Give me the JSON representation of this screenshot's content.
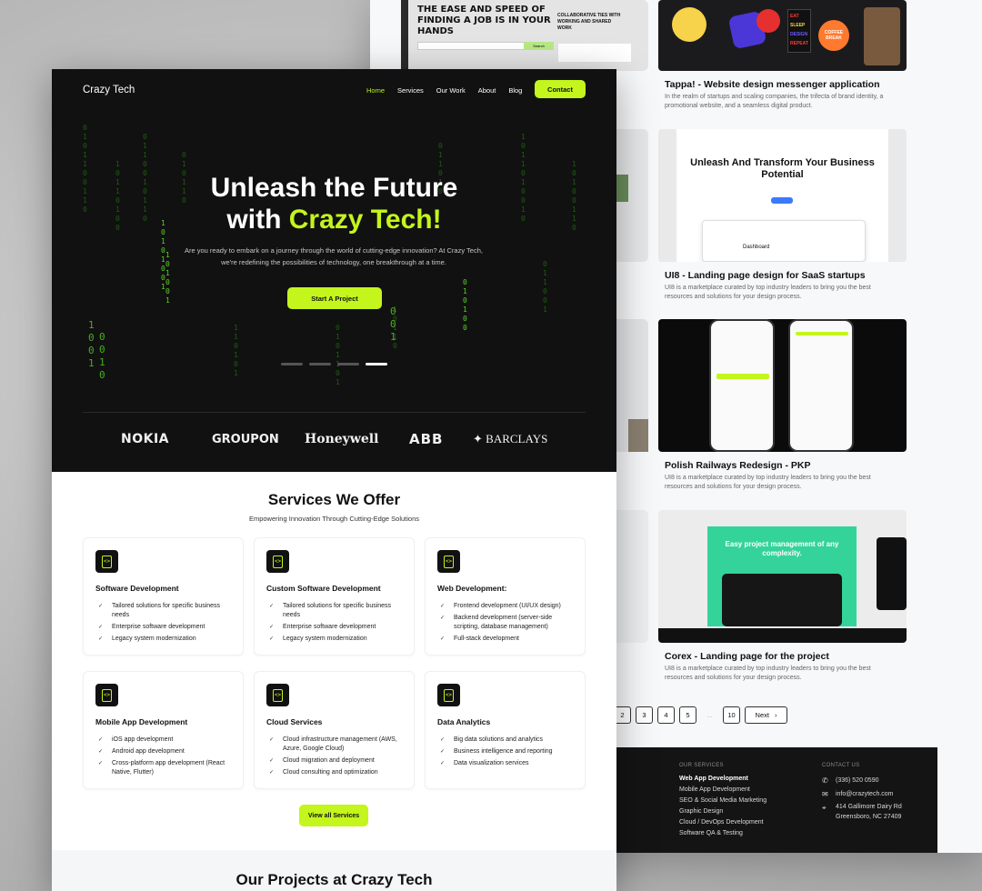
{
  "front": {
    "brand": "Crazy Tech",
    "nav": [
      "Home",
      "Services",
      "Our Work",
      "About",
      "Blog"
    ],
    "contact_label": "Contact",
    "hero": {
      "title_line1": "Unleash the Future",
      "title_line2_prefix": "with ",
      "title_line2_accent": "Crazy Tech!",
      "subtitle": "Are you ready to embark on a journey through the world of cutting-edge innovation? At Crazy Tech, we're redefining the possibilities of technology, one breakthrough at a time.",
      "cta": "Start A Project",
      "slides": 4,
      "active_slide": 4
    },
    "logos": [
      "NOKIA",
      "GROUPON",
      "Honeywell",
      "ABB",
      "BARCLAYS"
    ],
    "services": {
      "title": "Services We Offer",
      "subtitle": "Empowering Innovation Through Cutting-Edge Solutions",
      "cards": [
        {
          "title": "Software Development",
          "items": [
            "Tailored solutions for specific business needs",
            "Enterprise software development",
            "Legacy system modernization"
          ]
        },
        {
          "title": "Custom Software Development",
          "items": [
            "Tailored solutions for specific business needs",
            "Enterprise software development",
            "Legacy system modernization"
          ]
        },
        {
          "title": "Web Development:",
          "items": [
            "Frontend development (UI/UX design)",
            "Backend development (server-side scripting, database management)",
            "Full-stack development"
          ]
        },
        {
          "title": "Mobile App Development",
          "items": [
            "iOS app development",
            "Android app development",
            "Cross-platform app development (React Native, Flutter)"
          ]
        },
        {
          "title": "Cloud Services",
          "items": [
            "Cloud infrastructure management (AWS, Azure, Google Cloud)",
            "Cloud migration and deployment",
            "Cloud consulting and optimization"
          ]
        },
        {
          "title": "Data Analytics",
          "items": [
            "Big data solutions and analytics",
            "Business intelligence and reporting",
            "Data visualization services"
          ]
        }
      ],
      "view_all": "View all Services"
    },
    "projects_title": "Our Projects at Crazy Tech"
  },
  "back": {
    "projects": [
      {
        "title": "Tappa! - Website design messenger application",
        "desc": "In the realm of startups and scaling companies, the trifecta of brand identity, a promotional website, and a seamless digital product."
      },
      {
        "title": "UI8 - Landing page design for SaaS startups",
        "desc": "UI8 is a marketplace curated by top industry leaders to bring you the best resources and solutions for your design process."
      },
      {
        "title": "Polish Railways Redesign - PKP",
        "desc": "UI8 is a marketplace curated by top industry leaders to bring you the best resources and solutions for your design process."
      },
      {
        "title": "Corex - Landing page for the project",
        "desc": "UI8 is a marketplace curated by top industry leaders to bring you the best resources and solutions for your design process."
      }
    ],
    "thumbs": {
      "job_headline": "THE EASE AND SPEED OF FINDING A JOB IS IN YOUR HANDS",
      "job_side": "COLLABORATIVE TIES WITH WORKING AND SHARED WORK",
      "search_btn": "Search",
      "stickers": [
        "EAT",
        "SLEEP",
        "DESIGN",
        "REPEAT"
      ],
      "coffee": "COFFEE BREAK",
      "ui8_headline": "Unleash And Transform Your Business Potential",
      "ui8_dash": "Dashboard",
      "corex_headline": "Easy project management of any complexity."
    },
    "pagination": {
      "pages": [
        "2",
        "3",
        "4",
        "5",
        "...",
        "10"
      ],
      "next": "Next"
    },
    "footer": {
      "services_title": "OUR SERVICES",
      "services": [
        "Web App Development",
        "Mobile App Development",
        "SEO & Social Media Marketing",
        "Graphic Design",
        "Cloud / DevOps Development",
        "Software QA & Testing"
      ],
      "contact_title": "CONTACT US",
      "phone": "(336) 520 0590",
      "email": "info@crazytech.com",
      "address1": "414 Gallimore Dairy Rd",
      "address2": "Greensboro, NC 27409"
    }
  },
  "colors": {
    "accent": "#c4f51c",
    "dark": "#111111"
  }
}
